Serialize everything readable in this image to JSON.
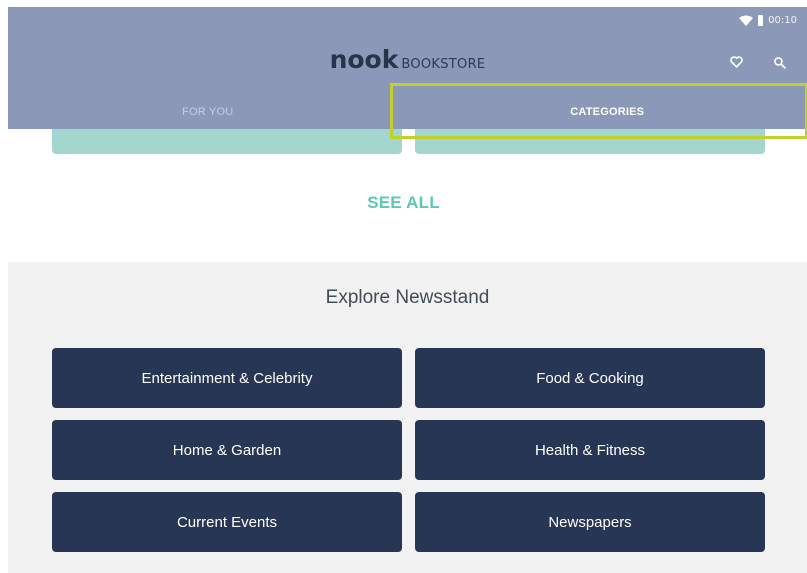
{
  "status_bar": {
    "time": "00:10",
    "icons": [
      "wifi-icon",
      "battery-icon"
    ]
  },
  "header": {
    "logo": "nook",
    "subtitle": "BOOKSTORE",
    "actions": [
      "heart-icon",
      "search-icon"
    ],
    "colors": {
      "background": "#8b98b8",
      "brand_text": "#27344c"
    }
  },
  "tabs": [
    {
      "label": "FOR YOU",
      "selected": false
    },
    {
      "label": "CATEGORIES",
      "selected": true
    }
  ],
  "highlight_color": "#c3cf2a",
  "see_all": "SEE ALL",
  "newsstand": {
    "title": "Explore Newsstand",
    "buttons": [
      "Entertainment & Celebrity",
      "Food & Cooking",
      "Home & Garden",
      "Health & Fitness",
      "Current Events",
      "Newspapers"
    ],
    "colors": {
      "button_bg": "#263654",
      "section_bg": "#f2f2f2"
    }
  },
  "accent_colors": {
    "teal_card": "#a3d6cf",
    "see_all": "#5fc7b6"
  }
}
